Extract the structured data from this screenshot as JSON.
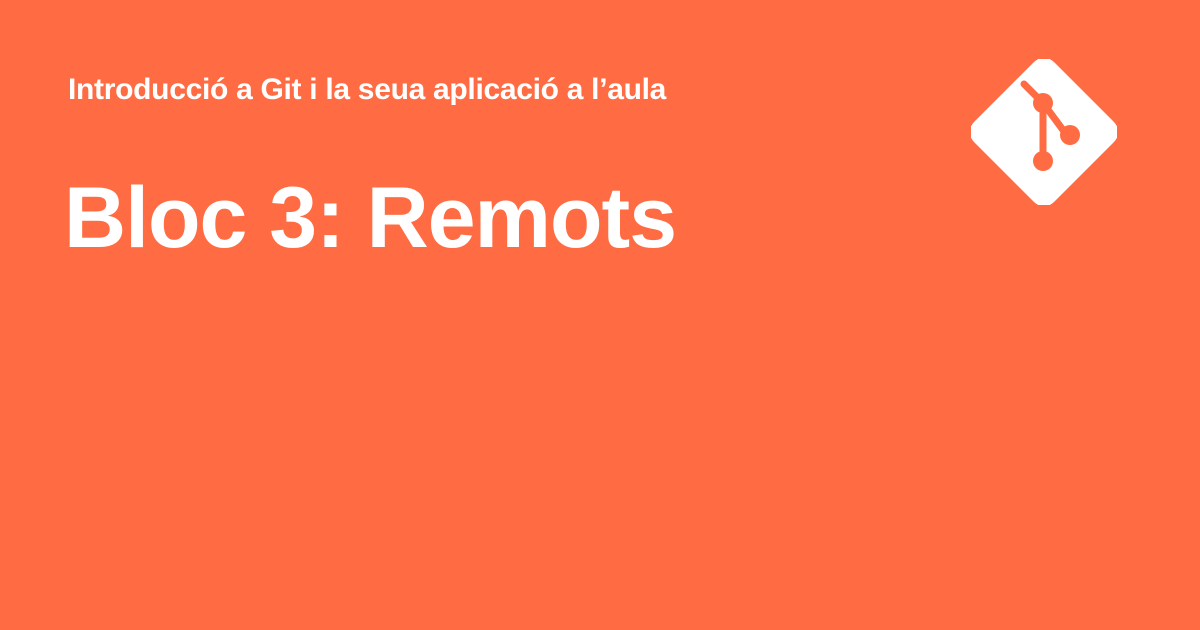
{
  "page": {
    "background_color": "#ff6c43",
    "text_color": "#ffffff"
  },
  "header": {
    "subtitle": "Introducció a Git i la seua aplicació a l’aula",
    "title": "Bloc 3: Remots"
  },
  "logo": {
    "icon": "git-logo-icon",
    "color": "#ffffff"
  }
}
